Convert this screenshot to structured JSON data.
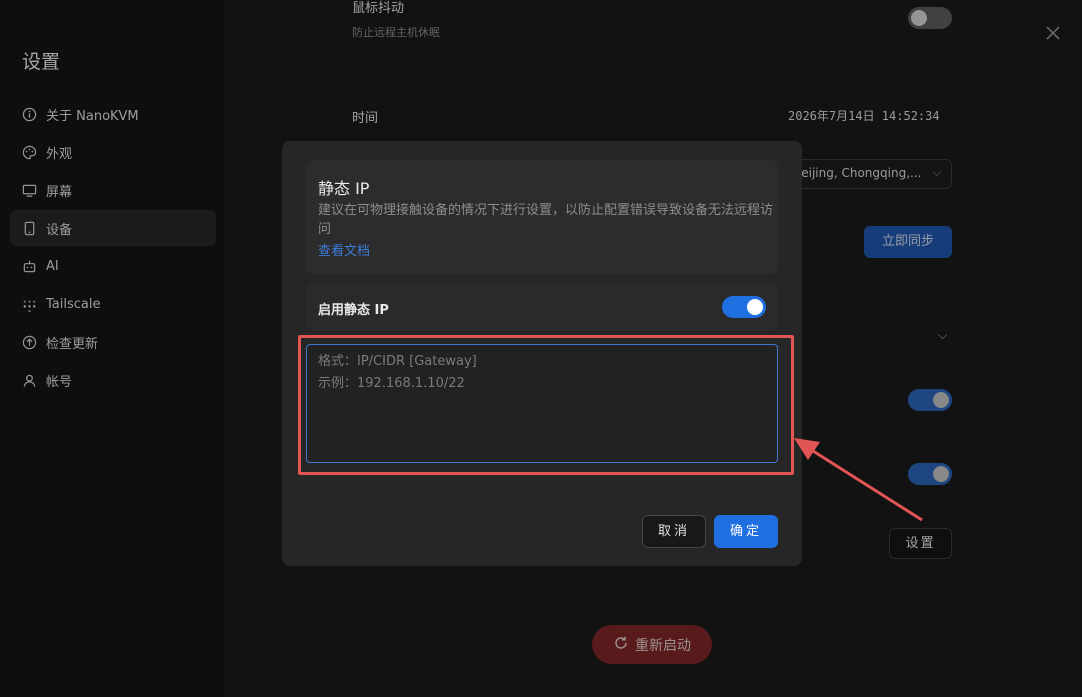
{
  "sidebar": {
    "title": "设置",
    "items": [
      {
        "icon": "info-icon",
        "label": "关于 NanoKVM"
      },
      {
        "icon": "palette-icon",
        "label": "外观"
      },
      {
        "icon": "monitor-icon",
        "label": "屏幕"
      },
      {
        "icon": "device-icon",
        "label": "设备"
      },
      {
        "icon": "robot-icon",
        "label": "AI"
      },
      {
        "icon": "tailscale-icon",
        "label": "Tailscale"
      },
      {
        "icon": "update-icon",
        "label": "检查更新"
      },
      {
        "icon": "user-icon",
        "label": "帐号"
      }
    ]
  },
  "settings": {
    "mouse_jiggle_label": "鼠标抖动",
    "mouse_jiggle_desc": "防止远程主机休眠",
    "time_label": "时间",
    "time_value": "2026年7月14日 14:52:34",
    "timezone_value": "Beijing, Chongqing,...",
    "sync_label": "立即同步",
    "set_label": "设置",
    "reboot_label": "重新启动"
  },
  "modal": {
    "title": "静态 IP",
    "description": "建议在可物理接触设备的情况下进行设置，以防止配置错误导致设备无法远程访问",
    "doc_link": "查看文档",
    "enable_label": "启用静态 IP",
    "enable_on": true,
    "ip_value": "",
    "ip_placeholder": "格式：IP/CIDR [Gateway]\n示例：192.168.1.10/22",
    "cancel_label": "取消",
    "confirm_label": "确定"
  },
  "colors": {
    "accent": "#1f6fe0",
    "highlight": "#e25555",
    "danger": "#7a2424"
  }
}
